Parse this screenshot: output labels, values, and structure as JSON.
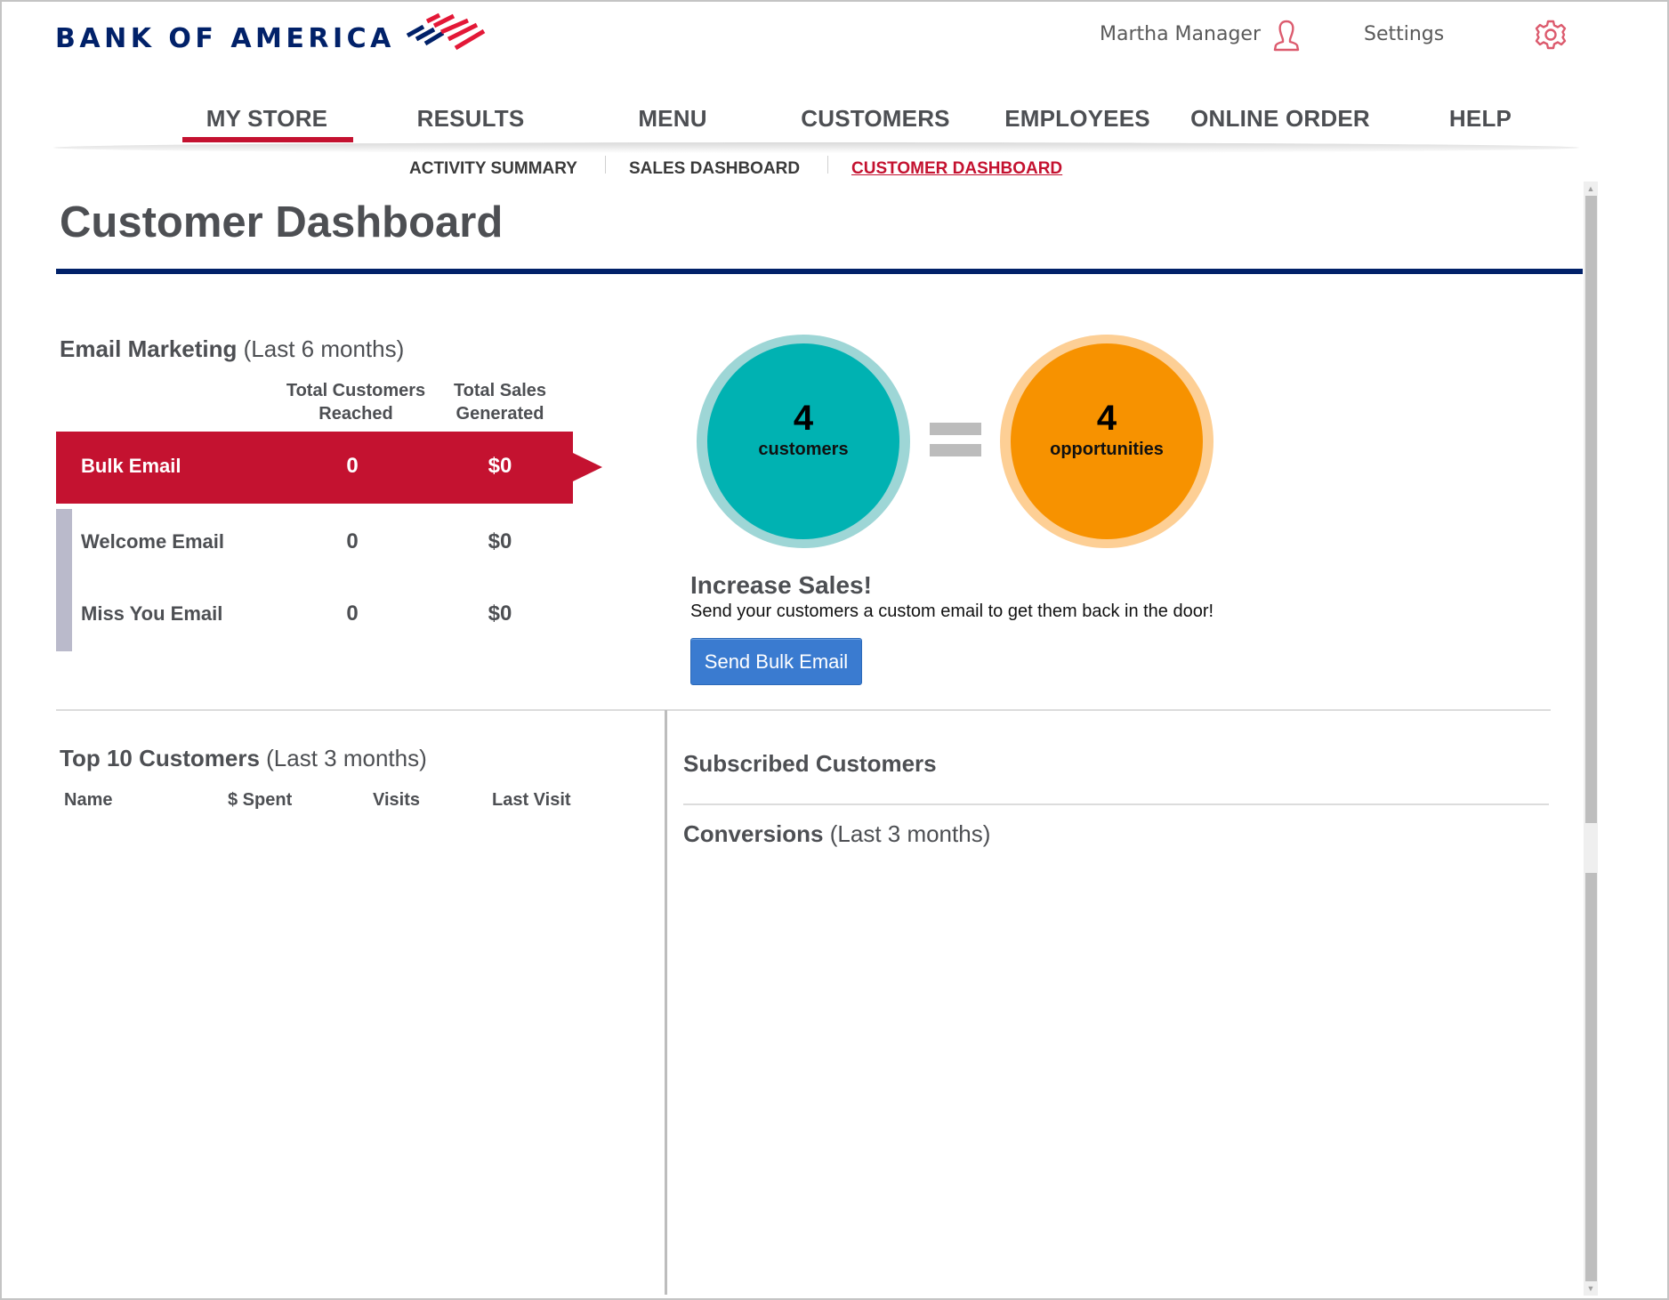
{
  "brand": {
    "name": "BANK OF AMERICA",
    "primary_color": "#012169",
    "accent_color": "#c41230"
  },
  "header": {
    "user_name": "Martha Manager",
    "user_icon": "person-icon",
    "settings_label": "Settings",
    "settings_icon": "gear-icon"
  },
  "main_nav": {
    "active": "MY STORE",
    "items": [
      {
        "label": "MY STORE"
      },
      {
        "label": "RESULTS"
      },
      {
        "label": "MENU"
      },
      {
        "label": "CUSTOMERS"
      },
      {
        "label": "EMPLOYEES"
      },
      {
        "label": "ONLINE ORDER"
      },
      {
        "label": "HELP"
      }
    ]
  },
  "sub_nav": {
    "active": "CUSTOMER DASHBOARD",
    "items": [
      {
        "label": "ACTIVITY SUMMARY"
      },
      {
        "label": "SALES DASHBOARD"
      },
      {
        "label": "CUSTOMER DASHBOARD"
      }
    ]
  },
  "page": {
    "title": "Customer Dashboard"
  },
  "email_marketing": {
    "heading": "Email Marketing",
    "period": "(Last 6 months)",
    "columns": {
      "reached_line1": "Total Customers",
      "reached_line2": "Reached",
      "sales_line1": "Total Sales",
      "sales_line2": "Generated"
    },
    "rows": [
      {
        "label": "Bulk Email",
        "reached": "0",
        "sales": "$0",
        "selected": true
      },
      {
        "label": "Welcome Email",
        "reached": "0",
        "sales": "$0",
        "selected": false
      },
      {
        "label": "Miss You Email",
        "reached": "0",
        "sales": "$0",
        "selected": false
      }
    ]
  },
  "opportunity": {
    "customers_count": "4",
    "customers_label": "customers",
    "opportunities_count": "4",
    "opportunities_label": "opportunities",
    "customers_color": "#00b2b2",
    "opportunities_color": "#f79200",
    "cta_heading": "Increase Sales!",
    "cta_text": "Send your customers a custom email to get them back in the door!",
    "cta_button": "Send Bulk Email"
  },
  "top_customers": {
    "heading": "Top 10 Customers",
    "period": "(Last 3 months)",
    "columns": [
      "Name",
      "$ Spent",
      "Visits",
      "Last Visit"
    ],
    "rows": []
  },
  "subscribed": {
    "heading": "Subscribed Customers"
  },
  "conversions": {
    "heading": "Conversions",
    "period": "(Last 3 months)"
  }
}
